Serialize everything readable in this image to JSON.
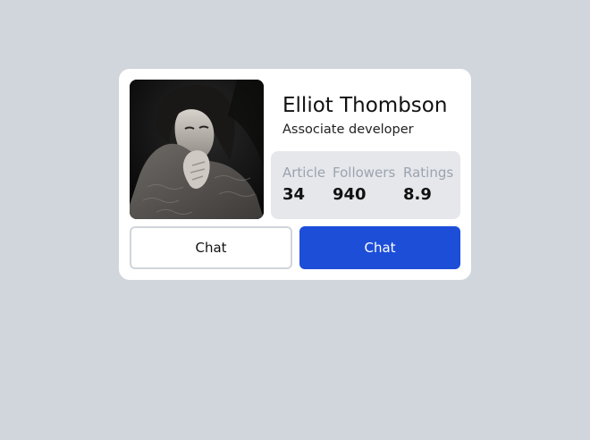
{
  "profile": {
    "name": "Elliot Thombson",
    "role": "Associate developer",
    "photo_icon": "profile-photo"
  },
  "stats": [
    {
      "label": "Article",
      "value": "34"
    },
    {
      "label": "Followers",
      "value": "940"
    },
    {
      "label": "Ratings",
      "value": "8.9"
    }
  ],
  "buttons": {
    "secondary_label": "Chat",
    "primary_label": "Chat"
  },
  "colors": {
    "page_background": "#d1d5dc",
    "card_background": "#ffffff",
    "stats_background": "#e5e7eb",
    "stat_label": "#9ca3af",
    "primary_button": "#1d4ed8",
    "outline_border": "#d1d5db"
  }
}
